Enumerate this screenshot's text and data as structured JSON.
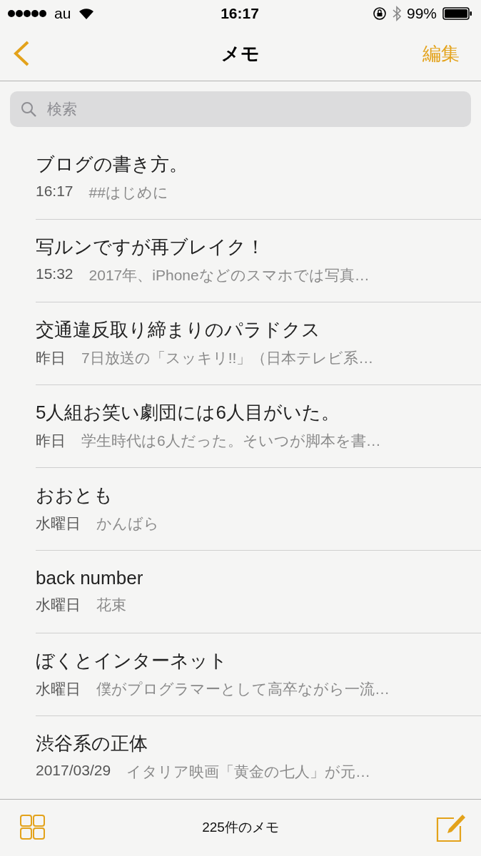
{
  "status_bar": {
    "carrier": "au",
    "time": "16:17",
    "battery": "99%"
  },
  "nav": {
    "title": "メモ",
    "edit": "編集"
  },
  "search": {
    "placeholder": "検索"
  },
  "notes": [
    {
      "title": "ブログの書き方。",
      "date": "16:17",
      "preview": "##はじめに"
    },
    {
      "title": "写ルンですが再ブレイク！",
      "date": "15:32",
      "preview": "2017年、iPhoneなどのスマホでは写真…"
    },
    {
      "title": "交通違反取り締まりのパラドクス",
      "date": "昨日",
      "preview": "7日放送の「スッキリ!!」（日本テレビ系…"
    },
    {
      "title": "5人組お笑い劇団には6人目がいた。",
      "date": "昨日",
      "preview": "学生時代は6人だった。そいつが脚本を書…"
    },
    {
      "title": "おおとも",
      "date": "水曜日",
      "preview": "かんばら"
    },
    {
      "title": "back number",
      "date": "水曜日",
      "preview": "花束"
    },
    {
      "title": "ぼくとインターネット",
      "date": "水曜日",
      "preview": "僕がプログラマーとして高卒ながら一流…"
    },
    {
      "title": "渋谷系の正体",
      "date": "2017/03/29",
      "preview": "イタリア映画「黄金の七人」が元…"
    }
  ],
  "toolbar": {
    "count": "225件のメモ"
  }
}
